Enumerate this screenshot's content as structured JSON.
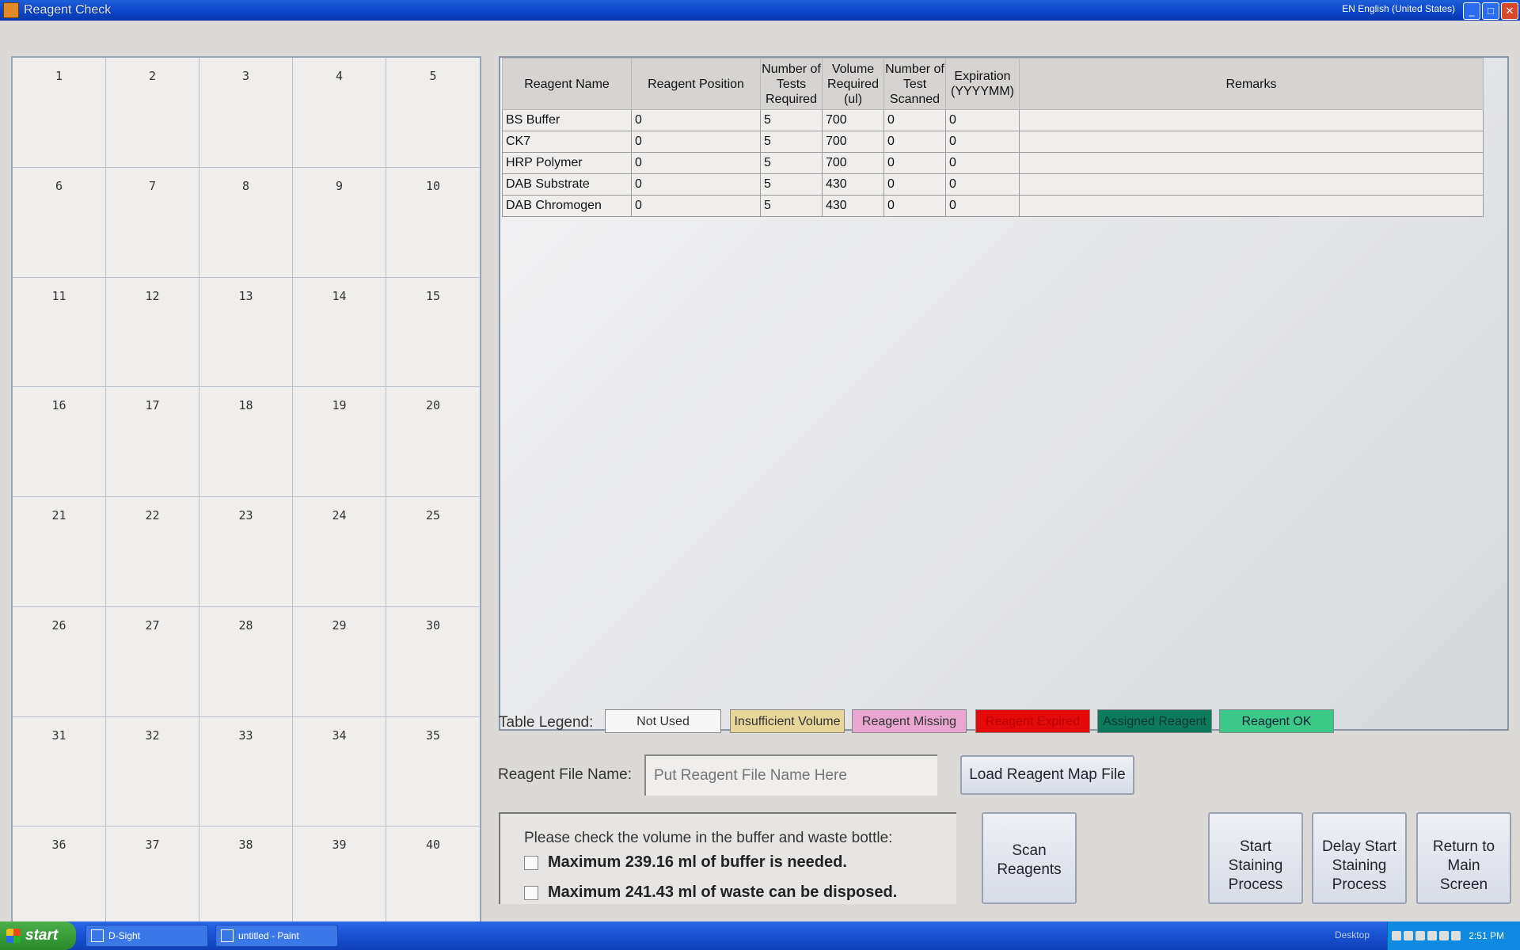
{
  "window": {
    "title": "Reagent Check",
    "language": "EN English (United States)",
    "minimize_glyph": "_",
    "maximize_glyph": "□",
    "close_glyph": "✕"
  },
  "grid_cells": [
    "1",
    "2",
    "3",
    "4",
    "5",
    "6",
    "7",
    "8",
    "9",
    "10",
    "11",
    "12",
    "13",
    "14",
    "15",
    "16",
    "17",
    "18",
    "19",
    "20",
    "21",
    "22",
    "23",
    "24",
    "25",
    "26",
    "27",
    "28",
    "29",
    "30",
    "31",
    "32",
    "33",
    "34",
    "35",
    "36",
    "37",
    "38",
    "39",
    "40"
  ],
  "table": {
    "headers": [
      "Reagent Name",
      "Reagent Position",
      "Number of Tests Required",
      "Volume Required (ul)",
      "Number of Test Scanned",
      "Expiration (YYYYMM)",
      "Remarks"
    ],
    "rows": [
      [
        "BS Buffer",
        "0",
        "5",
        "700",
        "0",
        "0",
        ""
      ],
      [
        "CK7",
        "0",
        "5",
        "700",
        "0",
        "0",
        ""
      ],
      [
        "HRP Polymer",
        "0",
        "5",
        "700",
        "0",
        "0",
        ""
      ],
      [
        "DAB Substrate",
        "0",
        "5",
        "430",
        "0",
        "0",
        ""
      ],
      [
        "DAB Chromogen",
        "0",
        "5",
        "430",
        "0",
        "0",
        ""
      ]
    ]
  },
  "legend": {
    "label": "Table Legend:",
    "items": [
      "Not Used",
      "Insufficient Volume",
      "Reagent Missing",
      "Reagent Expired",
      "Assigned Reagent",
      "Reagent OK"
    ]
  },
  "file": {
    "label": "Reagent File Name:",
    "placeholder": "Put Reagent File Name Here",
    "load_button": "Load Reagent Map File"
  },
  "volume_check": {
    "title": "Please check the volume in the buffer and waste bottle:",
    "buffer_text": "Maximum 239.16 ml of buffer is needed.",
    "waste_text": "Maximum 241.43 ml of waste can be disposed."
  },
  "buttons": {
    "scan": "Scan Reagents",
    "start": "Start Staining Process",
    "delay": "Delay Start Staining Process",
    "return": "Return to Main Screen"
  },
  "taskbar": {
    "start": "start",
    "task1": "D-Sight",
    "task2": "untitled - Paint",
    "desktop": "Desktop",
    "clock": "2:51 PM"
  }
}
